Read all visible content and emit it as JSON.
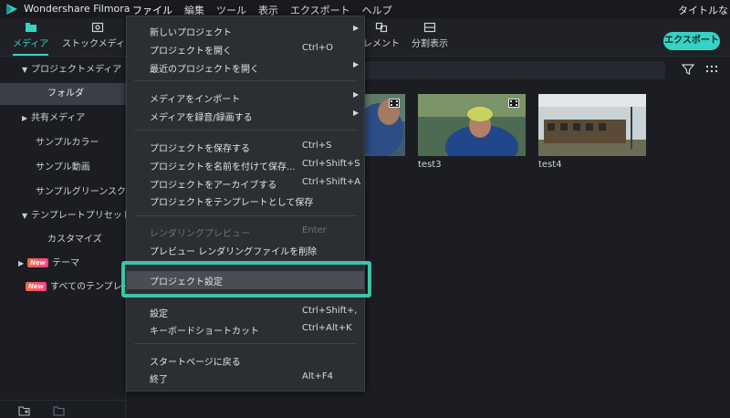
{
  "app": {
    "name": "Wondershare Filmora",
    "title_right": "タイトルな",
    "brand_color": "#35d3c4"
  },
  "menubar": {
    "items": [
      "ファイル",
      "編集",
      "ツール",
      "表示",
      "エクスポート",
      "ヘルプ"
    ]
  },
  "tabs": [
    {
      "label": "メディア",
      "icon": "folder-icon",
      "active": true
    },
    {
      "label": "ストックメディア",
      "icon": "stock-media-icon",
      "active": false
    },
    {
      "label": "レメント",
      "icon": "element-icon",
      "active": false
    },
    {
      "label": "分割表示",
      "icon": "split-screen-icon",
      "active": false
    }
  ],
  "export_button": "エクスポート",
  "sidebar": {
    "items": [
      {
        "label": "プロジェクトメディア",
        "expand": "down"
      },
      {
        "label": "フォルダ",
        "selected": true
      },
      {
        "label": "共有メディア",
        "expand": "right"
      },
      {
        "label": "サンプルカラー"
      },
      {
        "label": "サンプル動画"
      },
      {
        "label": "サンプルグリーンスクリーン"
      },
      {
        "label": "テンプレートプリセット",
        "expand": "down"
      },
      {
        "label": "カスタマイズ"
      },
      {
        "label": "テーマ",
        "badge": "New",
        "expand": "right"
      },
      {
        "label": "すべてのテンプレート",
        "badge": "New"
      }
    ]
  },
  "media": {
    "search_placeholder": "",
    "clips": [
      {
        "name": ""
      },
      {
        "name": "test3"
      },
      {
        "name": "test4"
      }
    ]
  },
  "file_menu": {
    "items": [
      {
        "label": "新しいプロジェクト",
        "shortcut": "",
        "submenu": true
      },
      {
        "label": "プロジェクトを開く",
        "shortcut": "Ctrl+O"
      },
      {
        "label": "最近のプロジェクトを開く",
        "shortcut": "",
        "submenu": true
      },
      {
        "label": "メディアをインポート",
        "shortcut": "",
        "submenu": true
      },
      {
        "label": "メディアを録音/録画する",
        "shortcut": "",
        "submenu": true
      },
      {
        "label": "プロジェクトを保存する",
        "shortcut": "Ctrl+S"
      },
      {
        "label": "プロジェクトを名前を付けて保存...",
        "shortcut": "Ctrl+Shift+S"
      },
      {
        "label": "プロジェクトをアーカイブする",
        "shortcut": "Ctrl+Shift+A"
      },
      {
        "label": "プロジェクトをテンプレートとして保存",
        "shortcut": ""
      },
      {
        "label": "レンダリングプレビュー",
        "shortcut": "Enter",
        "disabled": true
      },
      {
        "label": "プレビュー レンダリングファイルを削除",
        "shortcut": ""
      },
      {
        "label": "プロジェクト設定",
        "shortcut": "",
        "highlighted": true
      },
      {
        "label": "設定",
        "shortcut": "Ctrl+Shift+,"
      },
      {
        "label": "キーボードショートカット",
        "shortcut": "Ctrl+Alt+K"
      },
      {
        "label": "スタートページに戻る",
        "shortcut": ""
      },
      {
        "label": "終了",
        "shortcut": "Alt+F4"
      }
    ]
  },
  "colors": {
    "highlight_box": "#3cc3a7",
    "accent": "#35d3c4"
  }
}
